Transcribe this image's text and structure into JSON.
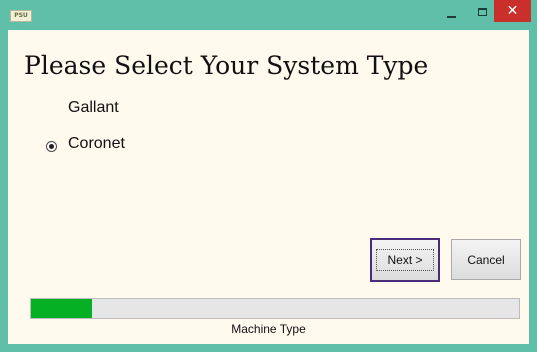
{
  "window": {
    "icon_text": "PSU",
    "controls": {
      "minimize": "–",
      "maximize": "□",
      "close": "✕"
    }
  },
  "page": {
    "title": "Please Select Your System Type"
  },
  "options": [
    {
      "label": "Gallant",
      "selected": false
    },
    {
      "label": "Coronet",
      "selected": true
    }
  ],
  "buttons": {
    "next": "Next >",
    "cancel": "Cancel"
  },
  "progress": {
    "fraction": 0.125,
    "label": "Machine Type",
    "color": "#06b025"
  }
}
